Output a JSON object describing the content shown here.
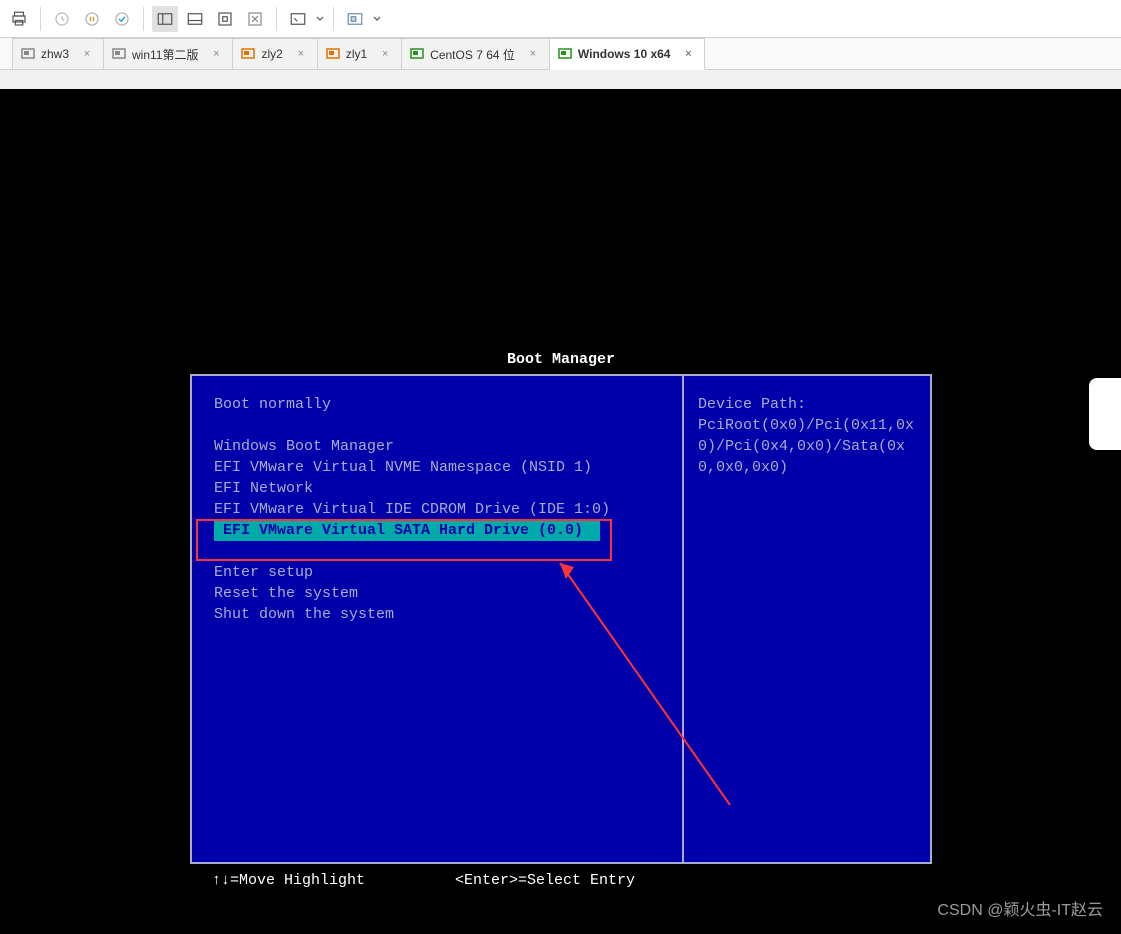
{
  "toolbar": {
    "buttons": [
      "print-icon",
      "recent-icon",
      "pause-icon",
      "play-icon",
      "sep",
      "tab-view-icon",
      "split-h-icon",
      "fit-guest-icon",
      "detach-icon",
      "sep",
      "fullscreen-icon",
      "sep",
      "unity-icon"
    ]
  },
  "tabs": [
    {
      "label": "zhw3",
      "icon": "vm-gray",
      "active": false
    },
    {
      "label": "win11第二版",
      "icon": "vm-gray",
      "active": false
    },
    {
      "label": "zly2",
      "icon": "vm-orange",
      "active": false
    },
    {
      "label": "zly1",
      "icon": "vm-orange",
      "active": false
    },
    {
      "label": "CentOS 7 64 位",
      "icon": "vm-green",
      "active": false
    },
    {
      "label": "Windows 10 x64",
      "icon": "vm-green",
      "active": true
    }
  ],
  "bios": {
    "title": "Boot Manager",
    "left_items": [
      {
        "text": "Boot normally",
        "blank_after": true
      },
      {
        "text": "Windows Boot Manager"
      },
      {
        "text": "EFI VMware Virtual NVME Namespace (NSID 1)"
      },
      {
        "text": "EFI Network"
      },
      {
        "text": "EFI VMware Virtual IDE CDROM Drive (IDE 1:0)"
      },
      {
        "text": "EFI VMware Virtual SATA Hard Drive (0.0)",
        "selected": true,
        "blank_after": true
      },
      {
        "text": "Enter setup"
      },
      {
        "text": "Reset the system"
      },
      {
        "text": "Shut down the system"
      }
    ],
    "right_title": "Device Path:",
    "right_body": "PciRoot(0x0)/Pci(0x11,0x0)/Pci(0x4,0x0)/Sata(0x0,0x0,0x0)",
    "footer_left": "↑↓=Move Highlight",
    "footer_right": "<Enter>=Select Entry"
  },
  "watermark": "CSDN @颖火虫-IT赵云"
}
